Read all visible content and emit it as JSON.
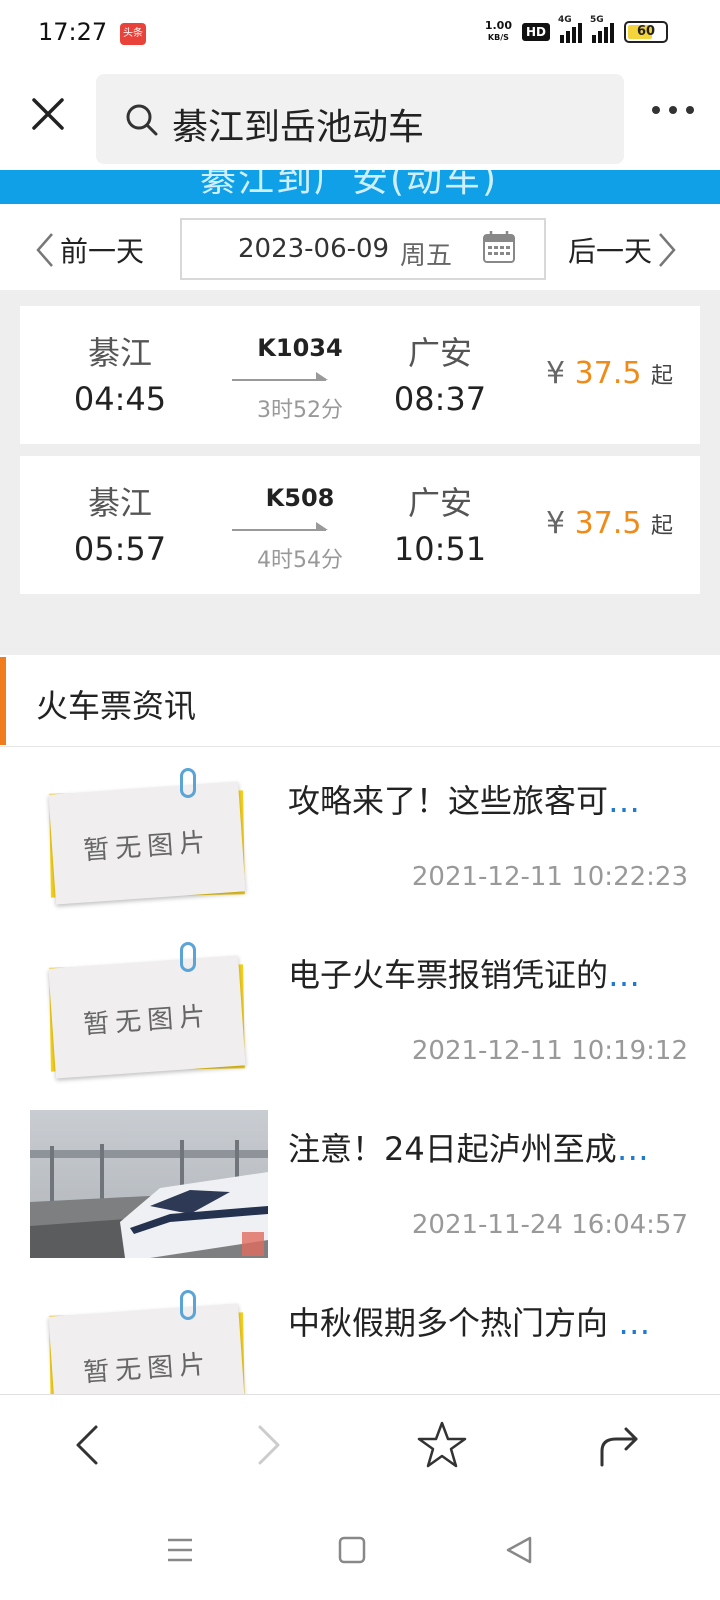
{
  "status_bar": {
    "time": "17:27",
    "app_badge": "头条",
    "net_speed_value": "1.00",
    "net_speed_unit": "KB/S",
    "hd": "HD",
    "sig1": "4G",
    "sig2": "5G",
    "battery": "60"
  },
  "search": {
    "query": "綦江到岳池动车"
  },
  "page_header": {
    "title_cutoff": "綦江到广安(动车)"
  },
  "date_bar": {
    "prev_label": "前一天",
    "date": "2023-06-09",
    "weekday": "周五",
    "next_label": "后一天"
  },
  "trains": [
    {
      "from": "綦江",
      "depart": "04:45",
      "number": "K1034",
      "duration": "3时52分",
      "to": "广安",
      "arrive": "08:37",
      "currency": "¥",
      "price": "37.5",
      "price_suffix": "起"
    },
    {
      "from": "綦江",
      "depart": "05:57",
      "number": "K508",
      "duration": "4时54分",
      "to": "广安",
      "arrive": "10:51",
      "currency": "¥",
      "price": "37.5",
      "price_suffix": "起"
    }
  ],
  "news": {
    "section_title": "火车票资讯",
    "no_image_text": "暂无图片",
    "ellipsis": "…",
    "items": [
      {
        "title": "攻略来了！这些旅客可",
        "time": "2021-12-11 10:22:23",
        "image": "placeholder"
      },
      {
        "title": "电子火车票报销凭证的",
        "time": "2021-12-11 10:19:12",
        "image": "placeholder"
      },
      {
        "title": "注意！24日起泸州至成",
        "time": "2021-11-24 16:04:57",
        "image": "photo-high-speed-train"
      },
      {
        "title": "中秋假期多个热门方向 ",
        "time": "",
        "image": "placeholder"
      }
    ]
  },
  "icons": {
    "close": "close-icon",
    "search": "search-icon",
    "more": "more-icon",
    "calendar": "calendar-icon",
    "back": "back-icon",
    "forward": "forward-icon",
    "bookmark": "star-icon",
    "share": "share-icon"
  },
  "colors": {
    "brand_blue": "#0fa0e8",
    "price_orange": "#f08a18",
    "section_accent": "#f07c1e",
    "link_blue": "#1f7ad0"
  }
}
